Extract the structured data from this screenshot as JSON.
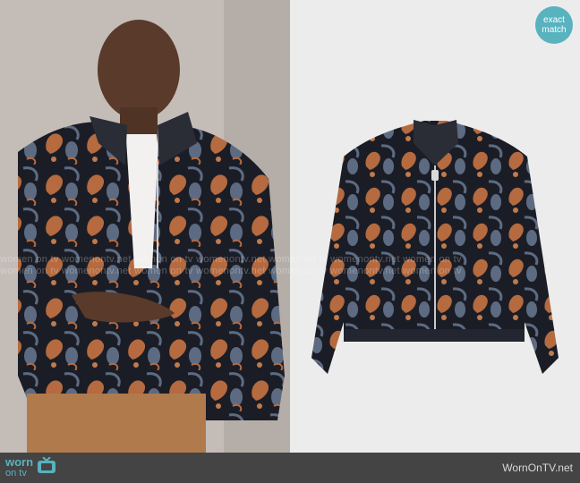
{
  "badge": {
    "line1": "exact",
    "line2": "match"
  },
  "watermark": {
    "line1": "women on tv  womenontv.net  women on tv  womenontv.net  women on tv  womenontv.net  women on tv",
    "line2": "women on tv  womenontv.net  women on tv  womenontv.net  women on tv  womenontv.net  women on tv"
  },
  "footer": {
    "logo_top": "worn",
    "logo_bottom": "on tv",
    "site": "WornOnTV.net"
  },
  "colors": {
    "accent": "#58b3bf",
    "footer_bg": "#444444",
    "jacket_base": "#1b1d26",
    "jacket_orange": "#b56a3f",
    "jacket_blue": "#5d6b82"
  }
}
